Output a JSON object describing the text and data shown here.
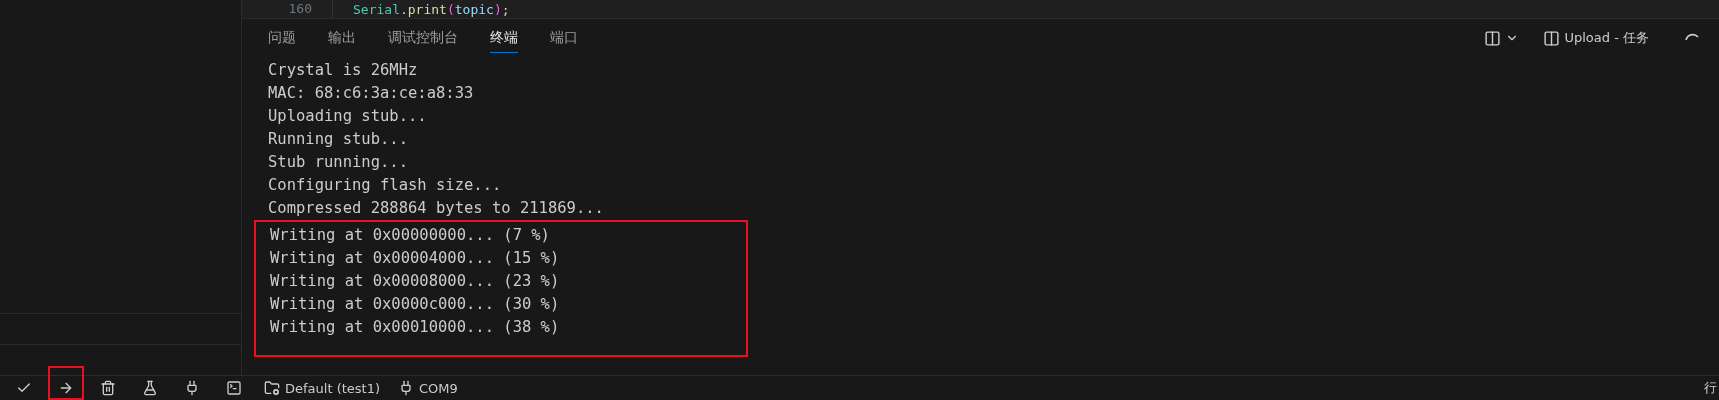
{
  "editor": {
    "line_number": "160",
    "tokens": [
      {
        "kind": "class",
        "text": "Serial"
      },
      {
        "kind": "plain",
        "text": "."
      },
      {
        "kind": "method",
        "text": "print"
      },
      {
        "kind": "bracket",
        "text": "("
      },
      {
        "kind": "variable",
        "text": "topic"
      },
      {
        "kind": "bracket",
        "text": ")"
      },
      {
        "kind": "plain",
        "text": ";"
      }
    ]
  },
  "panel": {
    "tabs": [
      {
        "label": "问题",
        "selected": false
      },
      {
        "label": "输出",
        "selected": false
      },
      {
        "label": "调试控制台",
        "selected": false
      },
      {
        "label": "终端",
        "selected": true
      },
      {
        "label": "端口",
        "selected": false
      }
    ],
    "task_label": "Upload - 任务",
    "task_running": true
  },
  "terminal": {
    "lines": [
      {
        "text": "Crystal is 26MHz",
        "highlighted": false
      },
      {
        "text": "MAC: 68:c6:3a:ce:a8:33",
        "highlighted": false
      },
      {
        "text": "Uploading stub...",
        "highlighted": false
      },
      {
        "text": "Running stub...",
        "highlighted": false
      },
      {
        "text": "Stub running...",
        "highlighted": false
      },
      {
        "text": "Configuring flash size...",
        "highlighted": false
      },
      {
        "text": "Compressed 288864 bytes to 211869...",
        "highlighted": false
      },
      {
        "text": "Writing at 0x00000000... (7 %)",
        "highlighted": true
      },
      {
        "text": "Writing at 0x00004000... (15 %)",
        "highlighted": true
      },
      {
        "text": "Writing at 0x00008000... (23 %)",
        "highlighted": true
      },
      {
        "text": "Writing at 0x0000c000... (30 %)",
        "highlighted": true
      },
      {
        "text": "Writing at 0x00010000... (38 %)",
        "highlighted": true
      }
    ]
  },
  "status_bar": {
    "actions": [
      {
        "kind": "check",
        "highlighted": false
      },
      {
        "kind": "arrow",
        "highlighted": true
      },
      {
        "kind": "trash",
        "highlighted": false
      },
      {
        "kind": "flask",
        "highlighted": false
      },
      {
        "kind": "plug",
        "highlighted": false
      },
      {
        "kind": "terminal",
        "highlighted": false
      }
    ],
    "environment": "Default (test1)",
    "port": "COM9",
    "right_text": "行"
  }
}
